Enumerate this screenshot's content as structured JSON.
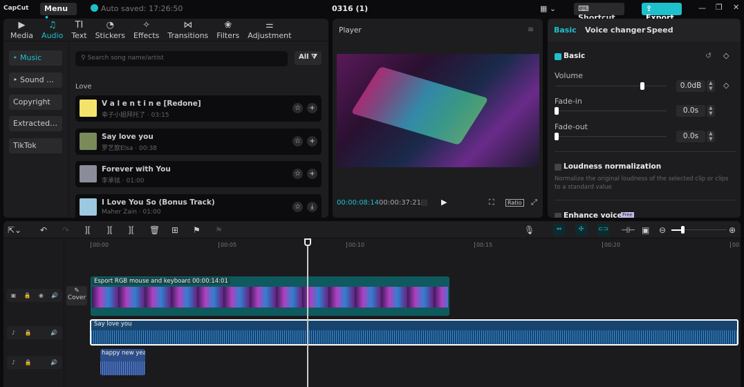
{
  "app": {
    "logo": "CapCut",
    "menu": "Menu",
    "autosave": "Auto saved: 17:26:50",
    "project_title": "0316 (1)",
    "shortcut": "Shortcut",
    "export": "Export"
  },
  "colors": {
    "accent": "#1ec0cc",
    "video_clip": "#0e5a5e",
    "audio_clip": "#1a4e7a"
  },
  "media_tabs": [
    {
      "label": "Media",
      "icon": "▶"
    },
    {
      "label": "Audio",
      "icon": "♫"
    },
    {
      "label": "Text",
      "icon": "TI"
    },
    {
      "label": "Stickers",
      "icon": "◔"
    },
    {
      "label": "Effects",
      "icon": "✧"
    },
    {
      "label": "Transitions",
      "icon": "⋈"
    },
    {
      "label": "Filters",
      "icon": "❀"
    },
    {
      "label": "Adjustment",
      "icon": "⚌"
    }
  ],
  "audio_sidebar": [
    "‣ Music",
    "‣ Sound effe...",
    "Copyright",
    "Extracted a...",
    "TikTok"
  ],
  "search": {
    "placeholder": "Search song name/artist",
    "filter": "All"
  },
  "section": "Love",
  "songs": [
    {
      "title": "V a l e n t i n e [Redone]",
      "meta": "幸子小姐拜托了 · 03:15",
      "action": "+"
    },
    {
      "title": "Say love you",
      "meta": "罗艺歆Elsa · 00:38",
      "action": "+"
    },
    {
      "title": "Forever with You",
      "meta": "李承铉 · 01:00",
      "action": "+"
    },
    {
      "title": "I Love You So (Bonus Track)",
      "meta": "Maher Zain · 01:00",
      "action": "⤓"
    }
  ],
  "player": {
    "title": "Player",
    "current": "00:00:08:14",
    "total": "00:00:37:21",
    "ratio": "Ratio"
  },
  "inspector": {
    "tabs": [
      "Basic",
      "Voice changer",
      "Speed"
    ],
    "section": "Basic",
    "volume": {
      "label": "Volume",
      "value": "0.0dB",
      "fraction": 0.78
    },
    "fade_in": {
      "label": "Fade-in",
      "value": "0.0s",
      "fraction": 0
    },
    "fade_out": {
      "label": "Fade-out",
      "value": "0.0s",
      "fraction": 0
    },
    "loudness": {
      "label": "Loudness normalization",
      "desc": "Normalize the original loudness of the selected clip or clips to a standard value"
    },
    "enhance": {
      "label": "Enhance voice",
      "badge": "Free"
    }
  },
  "timeline": {
    "ticks": [
      "00:00",
      "00:05",
      "00:10",
      "00:15",
      "00:20",
      "00"
    ],
    "zoom_fraction": 0.2,
    "video_clip": {
      "name": "Esport RGB mouse and keyboard",
      "duration": "00:00:14:01"
    },
    "audio_clip": "Say love you",
    "audio_clip2": "happy new yea",
    "cover": "Cover"
  }
}
